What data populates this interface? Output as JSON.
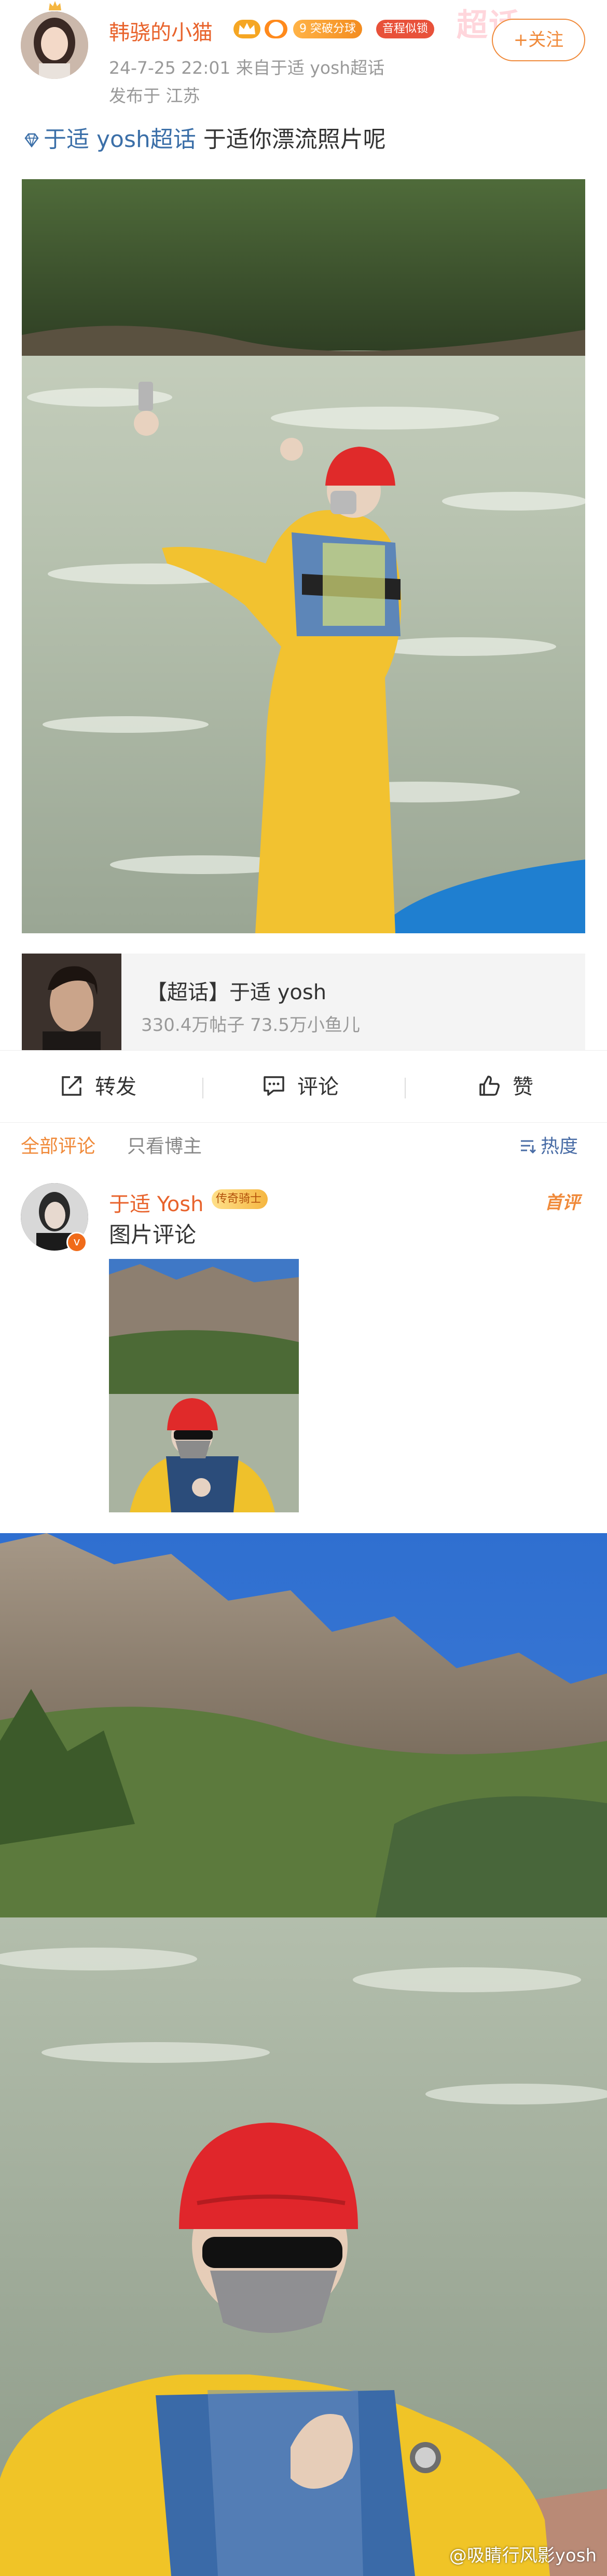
{
  "header": {
    "username": "韩骁的小猫",
    "badges": [
      "突破分球",
      "音程似锁"
    ],
    "level": "9",
    "meta": "24-7-25 22:01  来自于适 yosh超话",
    "location": "发布于  江苏",
    "supertopic_mark": "超话",
    "follow_label": "+关注"
  },
  "post": {
    "topic_link": "于适 yosh超话",
    "text": "于适你漂流照片呢"
  },
  "topic_card": {
    "title": "【超话】于适 yosh",
    "stats": "330.4万帖子  73.5万小鱼儿"
  },
  "actions": {
    "repost": "转发",
    "comment": "评论",
    "like": "赞"
  },
  "comment_tabs": {
    "all": "全部评论",
    "author_only": "只看博主",
    "sort": "热度"
  },
  "comment": {
    "name": "于适 Yosh",
    "badge": "传奇骑士",
    "top_label": "首评",
    "text": "图片评论",
    "verified": "v"
  },
  "watermark": "@吸睛行风影yosh",
  "colors": {
    "accent": "#f08a3a",
    "username": "#e8632c",
    "link": "#3b6fa8"
  }
}
